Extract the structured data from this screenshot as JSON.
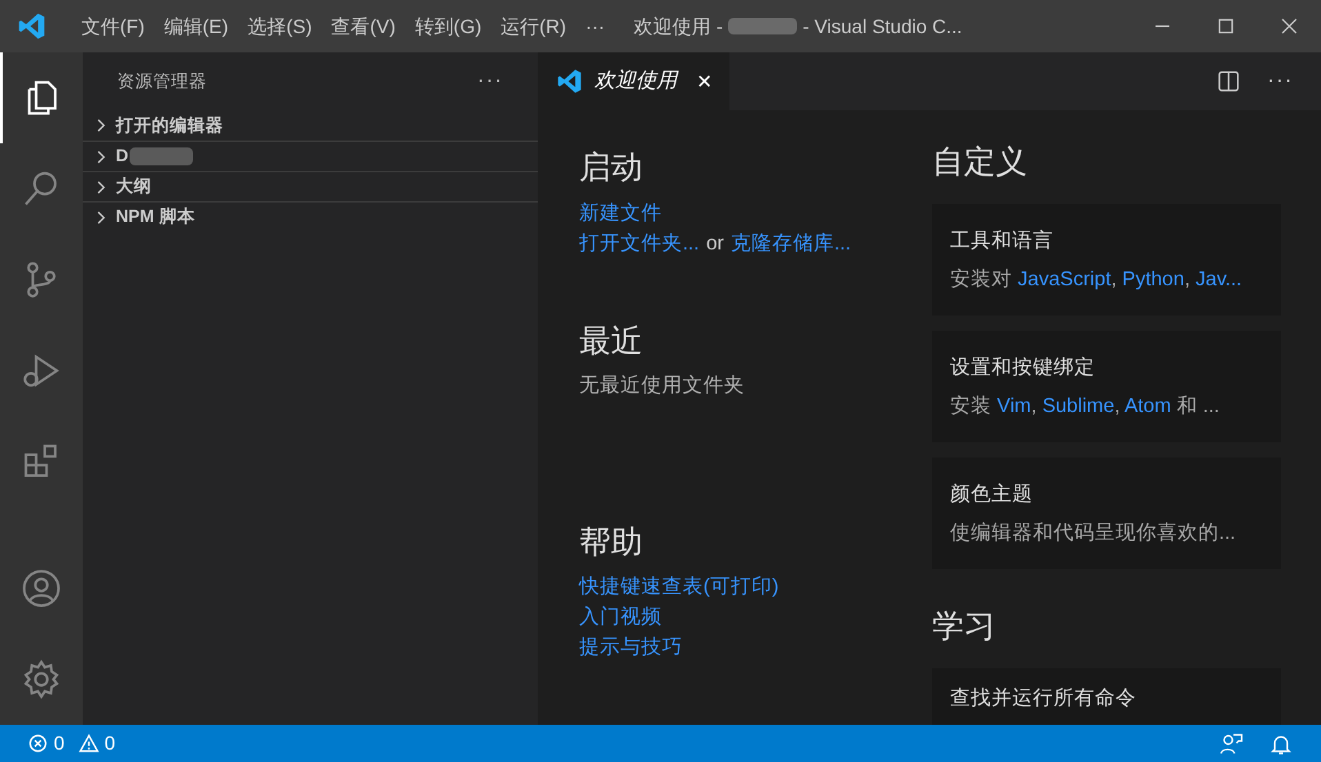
{
  "window": {
    "title_prefix": "欢迎使用 -",
    "title_suffix": "- Visual Studio C...",
    "redacted": true
  },
  "menu": [
    "文件(F)",
    "编辑(E)",
    "选择(S)",
    "查看(V)",
    "转到(G)",
    "运行(R)",
    "···"
  ],
  "activity_bar": [
    {
      "kind": "files",
      "selected": true
    },
    {
      "kind": "search",
      "selected": false
    },
    {
      "kind": "source-control",
      "selected": false
    },
    {
      "kind": "run-debug",
      "selected": false
    },
    {
      "kind": "extensions",
      "selected": false
    },
    {
      "kind": "account",
      "selected": false
    },
    {
      "kind": "settings",
      "selected": false
    }
  ],
  "sidebar": {
    "title": "资源管理器",
    "more": "···",
    "sections": [
      {
        "label": "打开的编辑器",
        "expanded": false
      },
      {
        "label": "D",
        "expanded": false,
        "redacted": true
      },
      {
        "label": "大纲",
        "expanded": false
      },
      {
        "label": "NPM 脚本",
        "expanded": false
      }
    ]
  },
  "tabs": [
    {
      "label": "欢迎使用",
      "close": "✕",
      "selected": true
    }
  ],
  "welcome": {
    "start": {
      "heading": "启动",
      "new_file": "新建文件",
      "open_folder": "打开文件夹...",
      "or": "or",
      "clone": "克隆存储库..."
    },
    "recent": {
      "heading": "最近",
      "empty": "无最近使用文件夹"
    },
    "help": {
      "heading": "帮助",
      "links": [
        "快捷键速查表(可打印)",
        "入门视频",
        "提示与技巧"
      ]
    },
    "customize": {
      "heading": "自定义",
      "cards": [
        {
          "title": "工具和语言",
          "desc": [
            {
              "text": "安装对 ",
              "link": false
            },
            {
              "text": "JavaScript",
              "link": true
            },
            {
              "text": ", ",
              "link": false
            },
            {
              "text": "Python",
              "link": true
            },
            {
              "text": ", ",
              "link": false
            },
            {
              "text": "Jav...",
              "link": true
            }
          ]
        },
        {
          "title": "设置和按键绑定",
          "desc": [
            {
              "text": "安装 ",
              "link": false
            },
            {
              "text": "Vim",
              "link": true
            },
            {
              "text": ", ",
              "link": false
            },
            {
              "text": "Sublime",
              "link": true
            },
            {
              "text": ", ",
              "link": false
            },
            {
              "text": "Atom",
              "link": true
            },
            {
              "text": " 和 ...",
              "link": false
            }
          ]
        },
        {
          "title": "颜色主题",
          "desc": [
            {
              "text": "使编辑器和代码呈现你喜欢的...",
              "link": false
            }
          ]
        }
      ]
    },
    "learn": {
      "heading": "学习",
      "cards": [
        {
          "title": "查找并运行所有命令"
        }
      ]
    }
  },
  "status_bar": {
    "errors": "0",
    "warnings": "0"
  }
}
